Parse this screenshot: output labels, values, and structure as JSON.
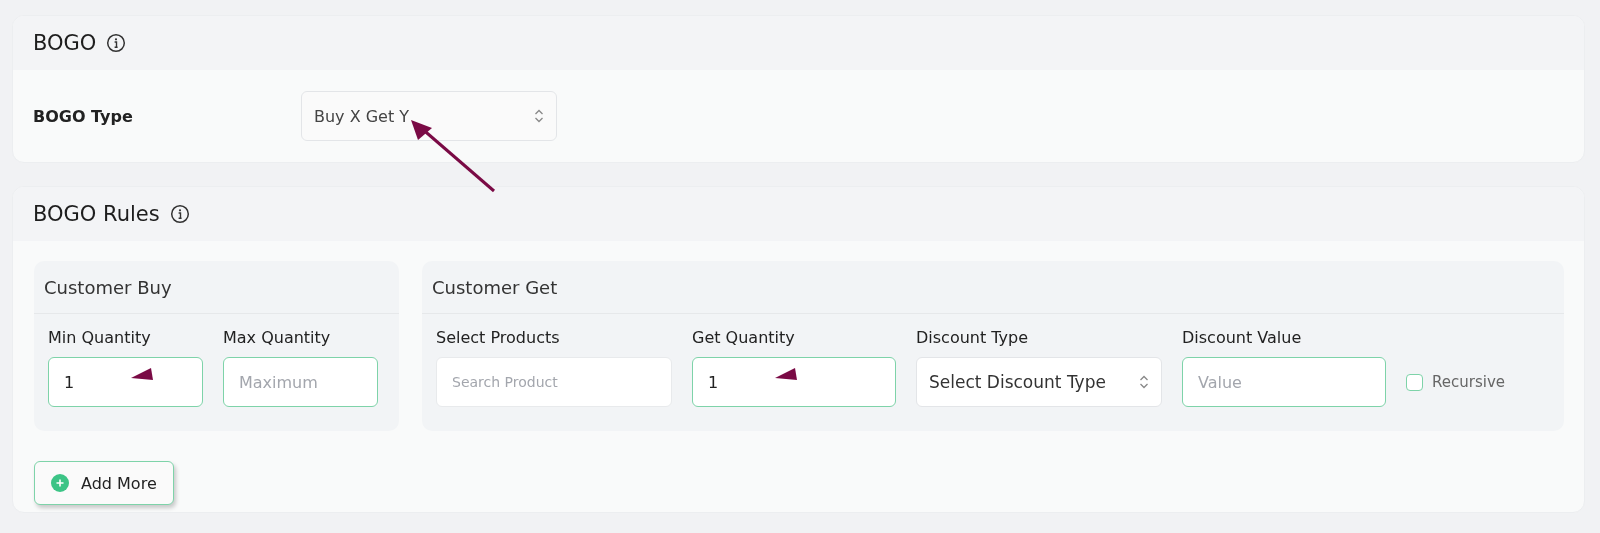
{
  "bogo_card": {
    "title": "BOGO",
    "bogo_type": {
      "label": "BOGO Type",
      "value": "Buy X Get Y"
    }
  },
  "rules_card": {
    "title": "BOGO Rules",
    "customer_buy": {
      "title": "Customer Buy",
      "fields": [
        {
          "kind": "input",
          "label": "Min Quantity",
          "value": "1"
        },
        {
          "kind": "input",
          "label": "Max Quantity",
          "placeholder": "Maximum"
        }
      ]
    },
    "customer_get": {
      "title": "Customer Get",
      "fields": [
        {
          "kind": "search",
          "label": "Select Products",
          "placeholder": "Search Product"
        },
        {
          "kind": "input",
          "label": "Get Quantity",
          "value": "1"
        },
        {
          "kind": "select",
          "label": "Discount Type",
          "value": "Select Discount Type"
        },
        {
          "kind": "input",
          "label": "Discount Value",
          "placeholder": "Value"
        },
        {
          "kind": "checkbox",
          "label": "Recursive",
          "checked": false
        }
      ]
    },
    "add_button": "Add More"
  }
}
